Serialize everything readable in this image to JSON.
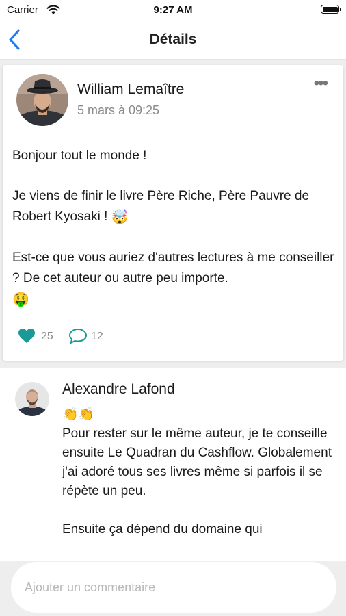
{
  "status_bar": {
    "carrier": "Carrier",
    "time": "9:27 AM"
  },
  "nav": {
    "title": "Détails",
    "back_icon": "chevron-left-icon"
  },
  "post": {
    "author": "William Lemaître",
    "date": "5 mars à 09:25",
    "paragraph_1": "Bonjour tout le monde !",
    "paragraph_2": "Je viens de finir le livre Père Riche, Père Pauvre de Robert Kyosaki !",
    "paragraph_2_emoji": "🤯",
    "paragraph_3": "Est-ce que vous auriez d'autres lectures à me conseiller ? De cet auteur ou autre peu importe.",
    "paragraph_3_emoji": "🤑",
    "likes": "25",
    "comments": "12",
    "accent_color": "#1a9a96"
  },
  "comment": {
    "author": "Alexandre Lafond",
    "emoji_line": "👏👏",
    "paragraph_1": "Pour rester sur le même auteur, je te conseille ensuite Le Quadran du Cashflow. Globalement j'ai adoré tous ses livres même si parfois il se répète un peu.",
    "paragraph_2": "Ensuite ça dépend du domaine qui"
  },
  "composer": {
    "placeholder": "Ajouter un commentaire"
  }
}
